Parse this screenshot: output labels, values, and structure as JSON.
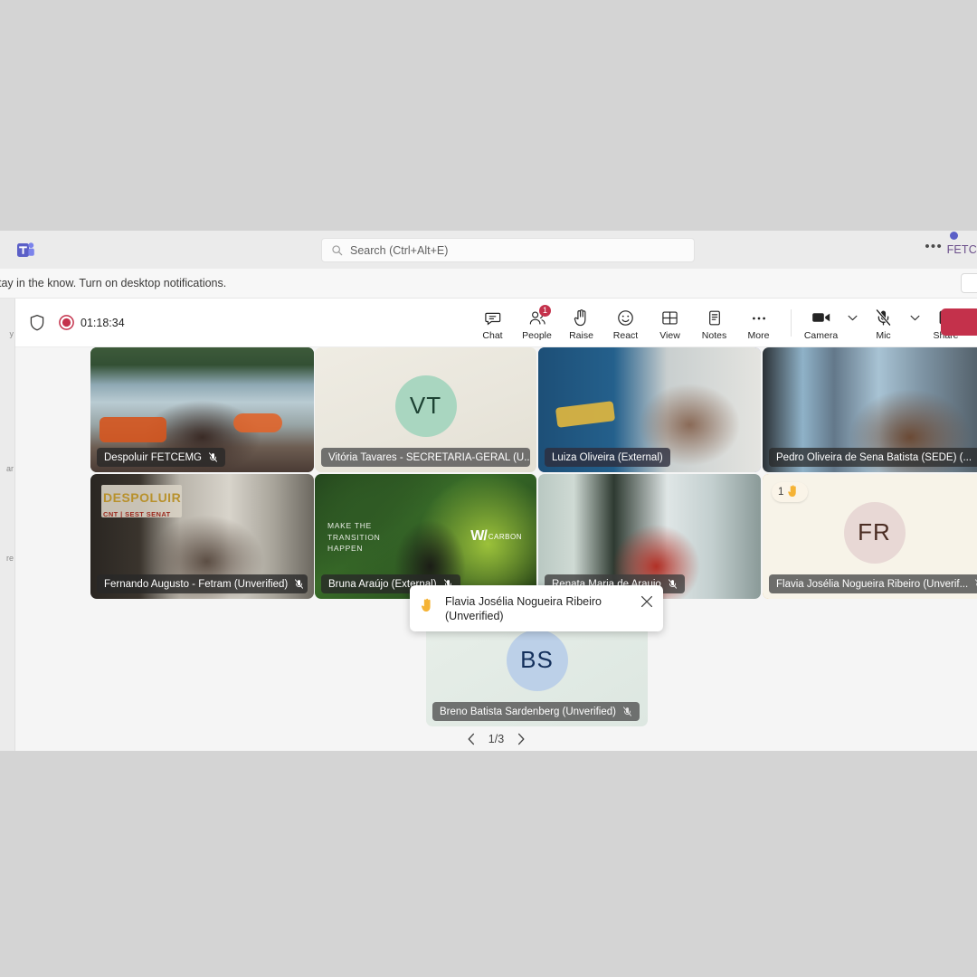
{
  "app": {
    "name": "Microsoft Teams",
    "logo_icon": "teams-logo-icon"
  },
  "titlebar": {
    "search_placeholder": "Search (Ctrl+Alt+E)",
    "search_icon": "search-icon",
    "more_icon": "ellipsis-icon",
    "account_initials": "FETC",
    "presence": "available"
  },
  "banner": {
    "text": "tay in the know. Turn on desktop notifications."
  },
  "left_rail": {
    "fragments": [
      "y",
      "ar",
      "re"
    ]
  },
  "meeting_toolbar": {
    "shield_icon": "shield-icon",
    "recording_icon": "record-icon",
    "timer": "01:18:34",
    "items": [
      {
        "label": "Chat",
        "icon": "chat-icon",
        "badge": null
      },
      {
        "label": "People",
        "icon": "people-icon",
        "badge": "1"
      },
      {
        "label": "Raise",
        "icon": "raise-hand-icon",
        "badge": null
      },
      {
        "label": "React",
        "icon": "react-emoji-icon",
        "badge": null
      },
      {
        "label": "View",
        "icon": "view-grid-icon",
        "badge": null
      },
      {
        "label": "Notes",
        "icon": "notes-icon",
        "badge": null
      },
      {
        "label": "More",
        "icon": "more-ellipsis-icon",
        "badge": null
      }
    ],
    "right_items": [
      {
        "label": "Camera",
        "icon": "camera-icon",
        "has_chevron": true,
        "state": "on"
      },
      {
        "label": "Mic",
        "icon": "mic-muted-icon",
        "has_chevron": true,
        "state": "muted"
      },
      {
        "label": "Share",
        "icon": "share-screen-icon",
        "has_chevron": false,
        "state": "off"
      }
    ],
    "hangup": {
      "label": "",
      "icon": "hangup-icon",
      "color": "#c4314b"
    }
  },
  "hand_toast": {
    "hand_icon": "raised-hand-emoji",
    "line1": "Flavia Josélia Nogueira Ribeiro",
    "line2": "(Unverified)",
    "close_icon": "close-icon"
  },
  "stage": {
    "tiles": [
      {
        "name": "Despoluir FETCEMG",
        "muted": true,
        "video": true,
        "bg_class": "bg-despoluir",
        "initials": null,
        "avatar_bg": null,
        "avatar_fg": null,
        "state": "normal",
        "hand_count": null,
        "watermark": null
      },
      {
        "name": "Vitória Tavares - SECRETARIA-GERAL (U...",
        "muted": true,
        "video": false,
        "bg_class": "bg-cream",
        "initials": "VT",
        "avatar_bg": "#a9d6c0",
        "avatar_fg": "#1d4233",
        "state": "normal",
        "hand_count": null,
        "watermark": null
      },
      {
        "name": "Luiza Oliveira (External)",
        "muted": false,
        "video": true,
        "bg_class": "bg-luiza",
        "initials": null,
        "avatar_bg": null,
        "avatar_fg": null,
        "state": "speaking",
        "hand_count": null,
        "watermark": null
      },
      {
        "name": "Pedro Oliveira de Sena Batista (SEDE) (...",
        "muted": true,
        "video": true,
        "bg_class": "bg-pedro",
        "initials": null,
        "avatar_bg": null,
        "avatar_fg": null,
        "state": "normal",
        "hand_count": null,
        "watermark": null
      },
      {
        "name": "Fernando Augusto - Fetram (Unverified)",
        "muted": true,
        "video": true,
        "bg_class": "bg-fernando",
        "initials": null,
        "avatar_bg": null,
        "avatar_fg": null,
        "state": "normal",
        "hand_count": null,
        "watermark": "DESPOLUIR"
      },
      {
        "name": "Bruna Araújo (External)",
        "muted": true,
        "video": true,
        "bg_class": "bg-bruna",
        "initials": null,
        "avatar_bg": null,
        "avatar_fg": null,
        "state": "normal",
        "hand_count": null,
        "watermark": "MAKE THE TRANSITION HAPPEN"
      },
      {
        "name": "Renata Maria de Araujo",
        "muted": true,
        "video": true,
        "bg_class": "bg-renata",
        "initials": null,
        "avatar_bg": null,
        "avatar_fg": null,
        "state": "normal",
        "hand_count": null,
        "watermark": null
      },
      {
        "name": "Flavia Josélia Nogueira Ribeiro (Unverif...",
        "muted": true,
        "video": false,
        "bg_class": "bg-flavia-av",
        "initials": "FR",
        "avatar_bg": "#e8d8d5",
        "avatar_fg": "#4a2c22",
        "state": "hand-raised",
        "hand_count": "1",
        "watermark": null
      },
      {
        "name": "Breno Batista Sardenberg (Unverified)",
        "muted": true,
        "video": false,
        "bg_class": "bg-bs",
        "initials": "BS",
        "avatar_bg": "#bcd0e8",
        "avatar_fg": "#14305c",
        "state": "normal",
        "hand_count": null,
        "watermark": null
      }
    ],
    "pager": {
      "prev_icon": "chevron-left-icon",
      "label": "1/3",
      "next_icon": "chevron-right-icon"
    }
  },
  "watermarks": {
    "bruna_brand": "CARBON",
    "bruna_line1": "MAKE THE",
    "bruna_line2": "TRANSITION",
    "bruna_line3": "HAPPEN",
    "fernando_brand": "DESPOLUIR",
    "fernando_sub": "CNT | SEST SENAT"
  },
  "colors": {
    "accent": "#5b5fc7",
    "speaking_ring": "#7a78d9",
    "hand_ring": "#d99316",
    "badge_red": "#c4314b",
    "hangup": "#c4314b"
  }
}
